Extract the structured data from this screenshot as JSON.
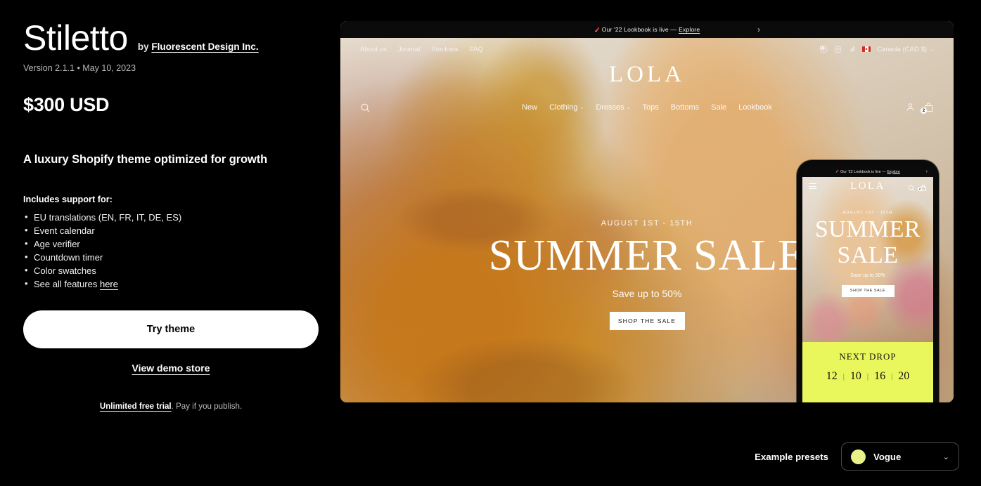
{
  "theme": {
    "name": "Stiletto",
    "by_prefix": "by",
    "vendor": "Fluorescent Design Inc.",
    "version_line": "Version 2.1.1 • May 10, 2023",
    "price": "$300 USD",
    "tagline": "A luxury Shopify theme optimized for growth",
    "includes_heading": "Includes support for:",
    "features": [
      "EU translations (EN, FR, IT, DE, ES)",
      "Event calendar",
      "Age verifier",
      "Countdown timer",
      "Color swatches"
    ],
    "see_all_prefix": "See all features",
    "see_all_link": "here",
    "try_button": "Try theme",
    "demo_link": "View demo store",
    "trial_link": "Unlimited free trial",
    "trial_rest": ". Pay if you publish."
  },
  "presets": {
    "label": "Example presets",
    "selected": "Vogue",
    "swatch_color": "#e9f28a",
    "chevron": "chevron-down-icon"
  },
  "preview": {
    "announcement": {
      "emoji": "lipstick-icon",
      "text": "Our '22 Lookbook is live —",
      "link": "Explore",
      "prev": "‹",
      "next": "›"
    },
    "utility_nav": [
      "About us",
      "Journal",
      "Stockists",
      "FAQ"
    ],
    "social": [
      "facebook-icon",
      "instagram-icon",
      "tiktok-icon"
    ],
    "locale": "Canada (CAD $)",
    "brand": "LOLA",
    "main_nav": [
      {
        "label": "New",
        "has_chevron": false
      },
      {
        "label": "Clothing",
        "has_chevron": true
      },
      {
        "label": "Dresses",
        "has_chevron": true
      },
      {
        "label": "Tops",
        "has_chevron": false
      },
      {
        "label": "Bottoms",
        "has_chevron": false
      },
      {
        "label": "Sale",
        "has_chevron": false
      },
      {
        "label": "Lookbook",
        "has_chevron": false
      }
    ],
    "cart_count": "2",
    "hero": {
      "kicker": "AUGUST 1ST - 15TH",
      "title": "SUMMER SALE",
      "subtitle": "Save up to 50%",
      "cta": "SHOP THE SALE"
    }
  },
  "mobile": {
    "announcement": {
      "text": "Our '22 Lookbook is live —",
      "link": "Explore",
      "prev": "‹",
      "next": "›"
    },
    "brand": "LOLA",
    "cart_count": "2",
    "hero": {
      "kicker": "AUGUST 1ST - 15TH",
      "title_line1": "SUMMER",
      "title_line2": "SALE",
      "subtitle": "Save up to 50%",
      "cta": "SHOP THE SALE"
    },
    "next_drop": {
      "title": "NEXT DROP",
      "values": [
        "12",
        "10",
        "16",
        "20"
      ]
    }
  }
}
